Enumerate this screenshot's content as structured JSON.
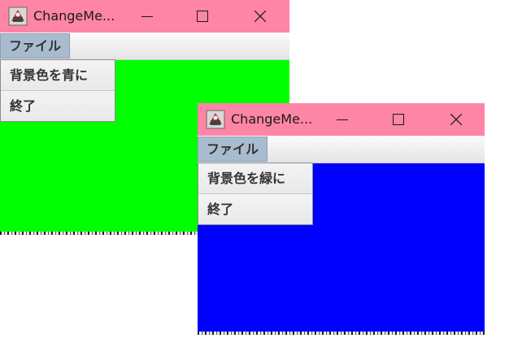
{
  "windows": [
    {
      "title": "ChangeMe...",
      "menu": "ファイル",
      "items": [
        "背景色を青に",
        "終了"
      ],
      "background_color": "#00ff00"
    },
    {
      "title": "ChangeMe...",
      "menu": "ファイル",
      "items": [
        "背景色を緑に",
        "終了"
      ],
      "background_color": "#0000ff"
    }
  ],
  "titlebar_color": "#ff85a6",
  "icons": {
    "app": "java-app-icon",
    "minimize": "minimize-icon",
    "maximize": "maximize-icon",
    "close": "close-icon"
  }
}
